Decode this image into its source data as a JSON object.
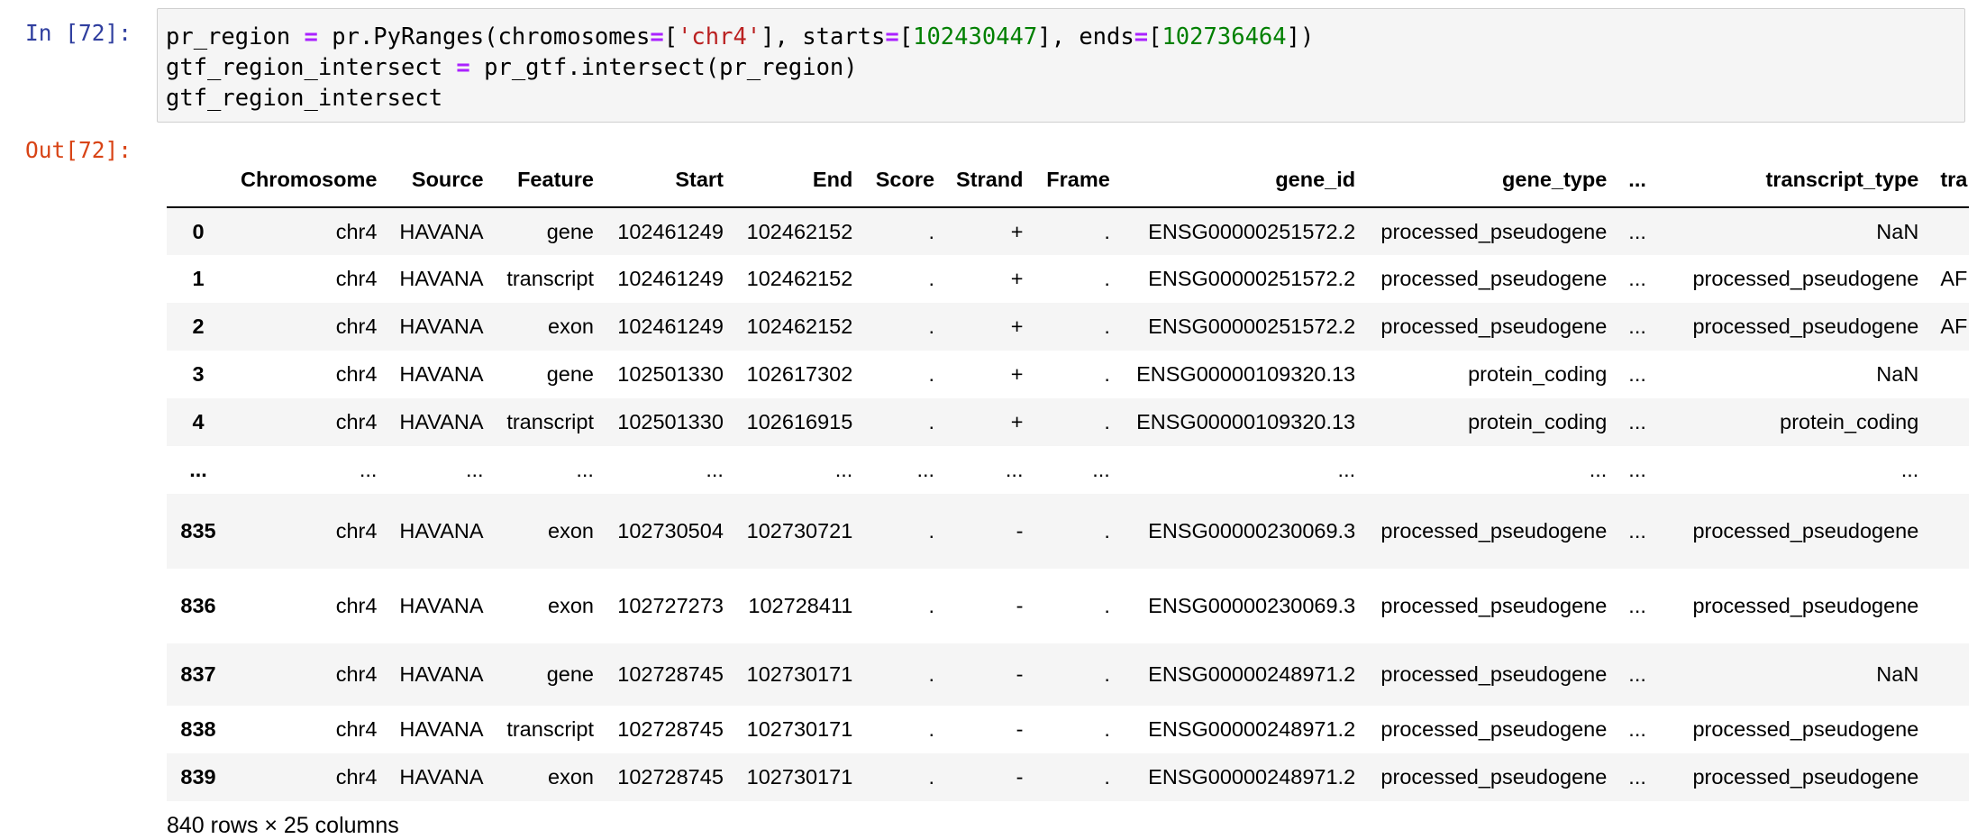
{
  "notebook": {
    "in_prompt": "In [72]:",
    "out_prompt": "Out[72]:",
    "code": {
      "line1": {
        "a": "pr_region ",
        "op1": "=",
        "b": " pr.PyRanges(chromosomes",
        "op2": "=",
        "c": "[",
        "str1": "'chr4'",
        "d": "], starts",
        "op3": "=",
        "e": "[",
        "num1": "102430447",
        "f": "], ends",
        "op4": "=",
        "g": "[",
        "num2": "102736464",
        "h": "])"
      },
      "line2": {
        "a": "gtf_region_intersect ",
        "op1": "=",
        "b": " pr_gtf.intersect(pr_region)"
      },
      "line3": "gtf_region_intersect"
    }
  },
  "dataframe": {
    "columns": [
      "",
      "Chromosome",
      "Source",
      "Feature",
      "Start",
      "End",
      "Score",
      "Strand",
      "Frame",
      "gene_id",
      "gene_type",
      "...",
      "transcript_type",
      "tra"
    ],
    "rows": [
      [
        "0",
        "chr4",
        "HAVANA",
        "gene",
        "102461249",
        "102462152",
        ".",
        "+",
        ".",
        "ENSG00000251572.2",
        "processed_pseudogene",
        "...",
        "NaN",
        ""
      ],
      [
        "1",
        "chr4",
        "HAVANA",
        "transcript",
        "102461249",
        "102462152",
        ".",
        "+",
        ".",
        "ENSG00000251572.2",
        "processed_pseudogene",
        "...",
        "processed_pseudogene",
        "AF"
      ],
      [
        "2",
        "chr4",
        "HAVANA",
        "exon",
        "102461249",
        "102462152",
        ".",
        "+",
        ".",
        "ENSG00000251572.2",
        "processed_pseudogene",
        "...",
        "processed_pseudogene",
        "AF"
      ],
      [
        "3",
        "chr4",
        "HAVANA",
        "gene",
        "102501330",
        "102617302",
        ".",
        "+",
        ".",
        "ENSG00000109320.13",
        "protein_coding",
        "...",
        "NaN",
        ""
      ],
      [
        "4",
        "chr4",
        "HAVANA",
        "transcript",
        "102501330",
        "102616915",
        ".",
        "+",
        ".",
        "ENSG00000109320.13",
        "protein_coding",
        "...",
        "protein_coding",
        ""
      ],
      [
        "...",
        "...",
        "...",
        "...",
        "...",
        "...",
        "...",
        "...",
        "...",
        "...",
        "...",
        "...",
        "...",
        ""
      ],
      [
        "835",
        "chr4",
        "HAVANA",
        "exon",
        "102730504",
        "102730721",
        ".",
        "-",
        ".",
        "ENSG00000230069.3",
        "processed_pseudogene",
        "...",
        "processed_pseudogene",
        ""
      ],
      [
        "836",
        "chr4",
        "HAVANA",
        "exon",
        "102727273",
        "102728411",
        ".",
        "-",
        ".",
        "ENSG00000230069.3",
        "processed_pseudogene",
        "...",
        "processed_pseudogene",
        ""
      ],
      [
        "837",
        "chr4",
        "HAVANA",
        "gene",
        "102728745",
        "102730171",
        ".",
        "-",
        ".",
        "ENSG00000248971.2",
        "processed_pseudogene",
        "...",
        "NaN",
        ""
      ],
      [
        "838",
        "chr4",
        "HAVANA",
        "transcript",
        "102728745",
        "102730171",
        ".",
        "-",
        ".",
        "ENSG00000248971.2",
        "processed_pseudogene",
        "...",
        "processed_pseudogene",
        ""
      ],
      [
        "839",
        "chr4",
        "HAVANA",
        "exon",
        "102728745",
        "102730171",
        ".",
        "-",
        ".",
        "ENSG00000248971.2",
        "processed_pseudogene",
        "...",
        "processed_pseudogene",
        ""
      ]
    ],
    "shape_caption": "840 rows × 25 columns"
  }
}
